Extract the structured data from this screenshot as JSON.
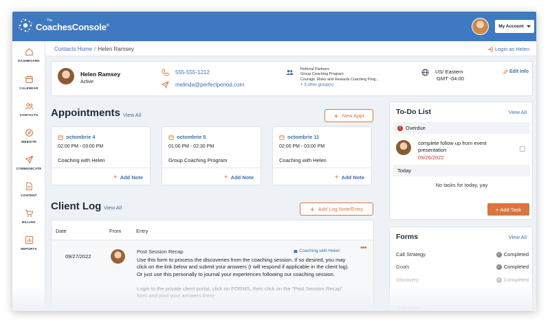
{
  "app": {
    "logo_small": "The",
    "logo_text": "CoachesConsole",
    "logo_mark": "®",
    "account_label": "My Account"
  },
  "sidebar": {
    "items": [
      {
        "label": "DASHBOARD",
        "icon": "home-icon"
      },
      {
        "label": "CALENDAR",
        "icon": "calendar-icon"
      },
      {
        "label": "CONTACTS",
        "icon": "contacts-icon"
      },
      {
        "label": "WEBSITE",
        "icon": "compass-icon"
      },
      {
        "label": "COMMUNICATE",
        "icon": "send-icon"
      },
      {
        "label": "CONTENT",
        "icon": "document-icon"
      },
      {
        "label": "BILLING",
        "icon": "cart-icon"
      },
      {
        "label": "REPORTS",
        "icon": "chart-icon"
      }
    ]
  },
  "breadcrumb": {
    "home": "Contacts Home",
    "separator": "/",
    "current": "Helen Ramsey",
    "login_as": "Login as Helen"
  },
  "contact": {
    "name": "Helen Ramsey",
    "status": "Active",
    "phone": "555-555-1212",
    "email": "melinda@perfectperiod.com",
    "groups_title": "Referral Partners",
    "group_1": "Group Coaching Program",
    "group_2": "Courage, Risks and Rewards Coaching Prog...",
    "more_groups": "+ 3 other group(s)",
    "timezone_1": "US/ Eastern",
    "timezone_2": "GMT -04:00",
    "edit_label": "Edit Info"
  },
  "appointments": {
    "title": "Appointments",
    "view_all": "View All",
    "new_label": "New Appt",
    "add_note": "Add Note",
    "items": [
      {
        "date": "octombrie 4",
        "time": "02:00 PM - 03:00 PM",
        "title": "Coaching with Helen"
      },
      {
        "date": "octombrie 5",
        "time": "01:00 PM - 02:30 PM",
        "title": "Group Coaching Program"
      },
      {
        "date": "octombrie 11",
        "time": "02:00 PM - 03:00 PM",
        "title": "Coaching with Helen"
      }
    ]
  },
  "client_log": {
    "title": "Client Log",
    "view_all": "View All",
    "add_label": "Add Log Note/Entry",
    "headers": {
      "date": "Date",
      "from": "From",
      "entry": "Entry"
    },
    "entry": {
      "date": "09/27/2022",
      "type": "Post Session Recap",
      "link": "Coaching with Helen",
      "menu": "•••",
      "body": "Use this form to process the discoveries from the coaching session. If so desired, you may click on the link below and submit your answers (I will respond if applicable in the client log). Or just use this personally to journal your experiences following our coaching session.",
      "body_faded": "Login to the private client portal, click on FORMS, then click on the \"Post Session Recap\" form and post your answers there"
    }
  },
  "todo": {
    "title": "To-Do List",
    "view_all": "View All",
    "overdue_label": "Overdue",
    "overdue_icon": "!",
    "task_text": "complete follow up from event presentation",
    "task_due": "09/26/2022",
    "today_label": "Today",
    "empty_text": "No tasks for today, yay",
    "add_label": "Add Task",
    "add_plus": "+"
  },
  "forms": {
    "title": "Forms",
    "view_all": "View All",
    "rows": [
      {
        "name": "Call Strategy",
        "status": "Completed"
      },
      {
        "name": "Goals",
        "status": "Completed"
      },
      {
        "name": "Discovery",
        "status": "Completed"
      }
    ],
    "next_section": "Agreem..."
  },
  "colors": {
    "brand_blue": "#3f79c1",
    "link_blue": "#3a6fb0",
    "accent_orange": "#d9763d",
    "overdue_red": "#c0392b"
  }
}
